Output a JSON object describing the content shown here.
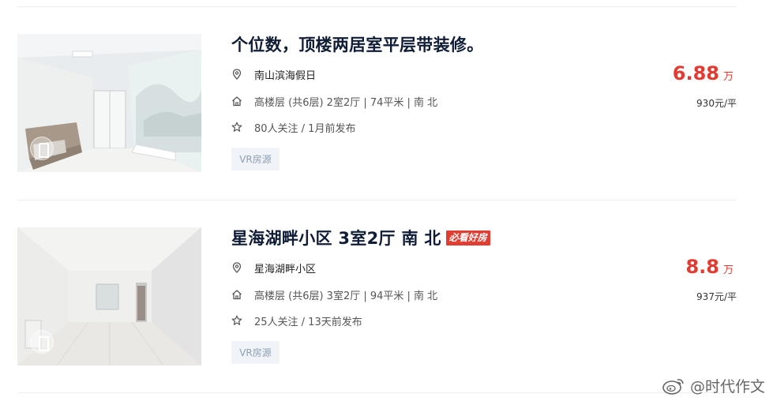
{
  "listings": [
    {
      "title": "个位数，顶楼两居室平层带装修。",
      "tag": "",
      "community": "南山滨海假日",
      "layout": "高楼层 (共6层) 2室2厅 | 74平米 | 南 北",
      "follow": "80人关注 / 1月前发布",
      "vr_label": "VR房源",
      "price": "6.88",
      "price_unit": "万",
      "unit_price": "930元/平"
    },
    {
      "title": "星海湖畔小区 3室2厅 南 北",
      "tag": "必看好房",
      "community": "星海湖畔小区",
      "layout": "高楼层 (共6层) 3室2厅 | 94平米 | 南 北",
      "follow": "25人关注 / 13天前发布",
      "vr_label": "VR房源",
      "price": "8.8",
      "price_unit": "万",
      "unit_price": "937元/平"
    }
  ],
  "icons": {
    "location": "location-pin-icon",
    "house": "house-icon",
    "star": "star-icon",
    "vr": "vr-phone-icon",
    "weibo": "weibo-logo-icon"
  },
  "watermark": {
    "text": "@时代作文"
  },
  "colors": {
    "price": "#e33b31",
    "title": "#101d37",
    "tag_bg": "#e03d33",
    "chip_bg": "#f0f3f7",
    "chip_text": "#8d9fb3"
  }
}
